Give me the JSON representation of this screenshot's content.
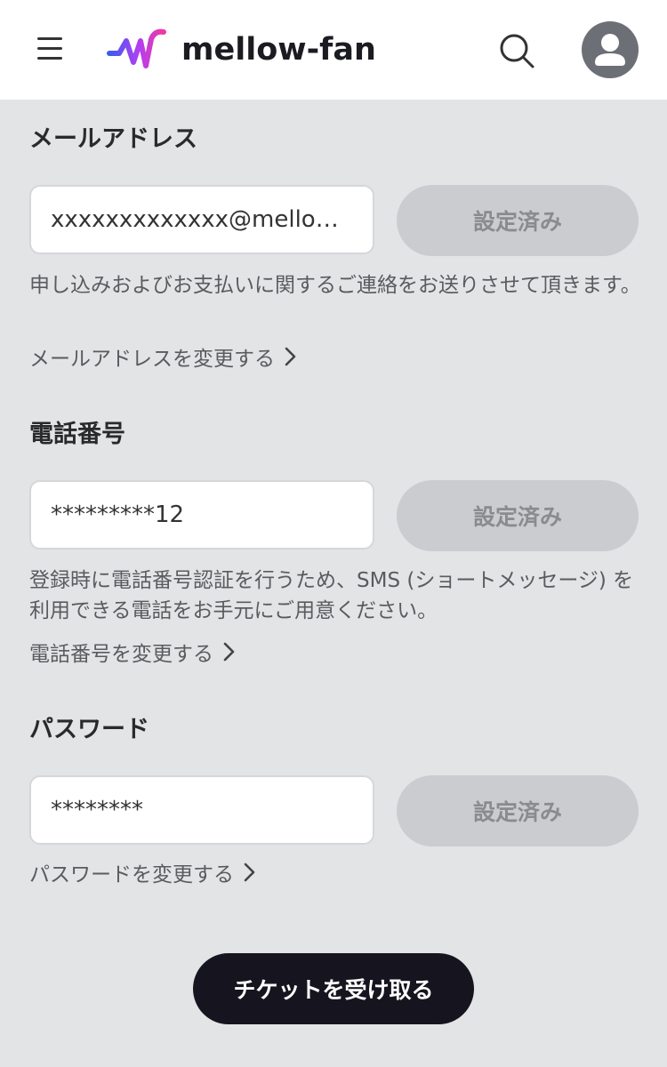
{
  "header": {
    "brand": "mellow-fan"
  },
  "colors": {
    "background": "#e3e4e6",
    "header_bg": "#ffffff",
    "disabled_button": "#cbcccf",
    "cta": "#16151f",
    "logo_gradient": [
      "#3b5cf0",
      "#b33ef2",
      "#f03aa0"
    ]
  },
  "sections": {
    "email": {
      "title": "メールアドレス",
      "value": "xxxxxxxxxxxxx@mellow-fan.com",
      "button": "設定済み",
      "description": "申し込みおよびお支払いに関するご連絡をお送りさせて頂きます。",
      "change_link": "メールアドレスを変更する"
    },
    "phone": {
      "title": "電話番号",
      "value": "*********12",
      "button": "設定済み",
      "description": "登録時に電話番号認証を行うため、SMS (ショートメッセージ) を利用できる電話をお手元にご用意ください。",
      "change_link": "電話番号を変更する"
    },
    "password": {
      "title": "パスワード",
      "value": "********",
      "button": "設定済み",
      "change_link": "パスワードを変更する"
    }
  },
  "cta": {
    "label": "チケットを受け取る"
  }
}
